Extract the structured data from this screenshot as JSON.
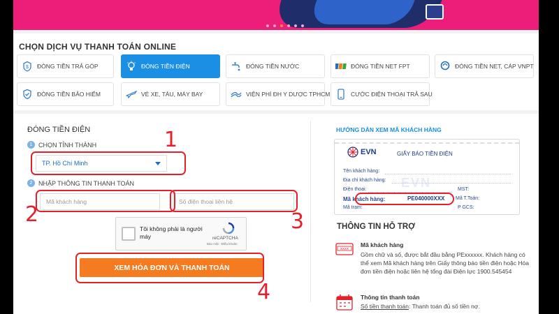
{
  "banner": {
    "slide_count": 6,
    "active_slide": 3
  },
  "services": {
    "title": "CHỌN DỊCH VỤ THANH TOÁN ONLINE",
    "items": [
      {
        "label": "ĐÓNG TIỀN TRẢ GÓP",
        "icon": "installment-icon"
      },
      {
        "label": "ĐÓNG TIỀN ĐIỆN",
        "icon": "lightbulb-icon",
        "active": true
      },
      {
        "label": "ĐÓNG TIỀN NƯỚC",
        "icon": "faucet-icon"
      },
      {
        "label": "ĐÓNG TIỀN NET FPT",
        "icon": "fpt-logo-icon"
      },
      {
        "label": "ĐÓNG TIỀN NET, CÁP VNPT",
        "icon": "vnpt-logo-icon"
      },
      {
        "label": "ĐÓNG TIỀN BẢO HIỂM",
        "icon": "shield-icon"
      },
      {
        "label": "VÉ XE, TÀU, MÁY BAY",
        "icon": "airplane-icon"
      },
      {
        "label": "VIỆN PHÍ ĐH Y DƯỢC TPHCM",
        "icon": "hospital-icon"
      },
      {
        "label": "CƯỚC ĐIỆN THOẠI TRẢ SAU",
        "icon": "phone-icon"
      }
    ]
  },
  "form": {
    "title": "ĐÓNG TIỀN ĐIỆN",
    "step1": {
      "num": "1",
      "label": "CHỌN TỈNH THÀNH"
    },
    "province_value": "TP. Hồ Chí Minh",
    "step2": {
      "num": "2",
      "label": "NHẬP THÔNG TIN THANH TOÁN"
    },
    "customer_code_placeholder": "Mã khách hàng",
    "phone_placeholder": "Số điện thoại liên hệ",
    "captcha": {
      "label": "Tôi không phải là người máy",
      "brand": "reCAPTCHA",
      "terms": "Bảo mật - Điều khoản"
    },
    "submit_label": "XEM HÓA ĐƠN VÀ THANH TOÁN"
  },
  "guide": {
    "title": "HƯỚNG DẪN XEM MÃ KHÁCH HÀNG",
    "bill": {
      "logo": "EVN",
      "heading": "GIẤY BÁO TIỀN ĐIỆN",
      "rows": [
        "Tên khách hàng:",
        "Địa chỉ khách hàng:",
        "Điện thoại:",
        "Mã khách hàng:",
        "Mã trạm:"
      ],
      "right_rows": [
        "MST:",
        "Mã T.Toán:",
        "P GCS:"
      ],
      "code": "PE040000XXX",
      "watermark": "EVN"
    }
  },
  "support": {
    "title": "THÔNG TIN HỖ TRỢ",
    "items": [
      {
        "heading": "Mã khách hàng",
        "text": "Gồm chữ và số, được bắt đầu bằng PExxxxxx. Khách hàng có thể xem Mã khách hàng trên Giấy thông báo tiền điện hoặc Hóa đơn tiền điện hoặc liên hệ tổng đài Điện lực 1900.545454",
        "icon_text": "XXXX"
      },
      {
        "heading": "Thông tin thanh toán",
        "link": "Số tiền thanh toán",
        "text": ": Thanh toán đủ số tiền nợ."
      }
    ]
  },
  "annotations": [
    "1",
    "2",
    "3",
    "4"
  ],
  "colors": {
    "banner": "#ec1e79",
    "active_service": "#1a8fe3",
    "submit": "#f47b20",
    "annotation": "#e5202a"
  }
}
